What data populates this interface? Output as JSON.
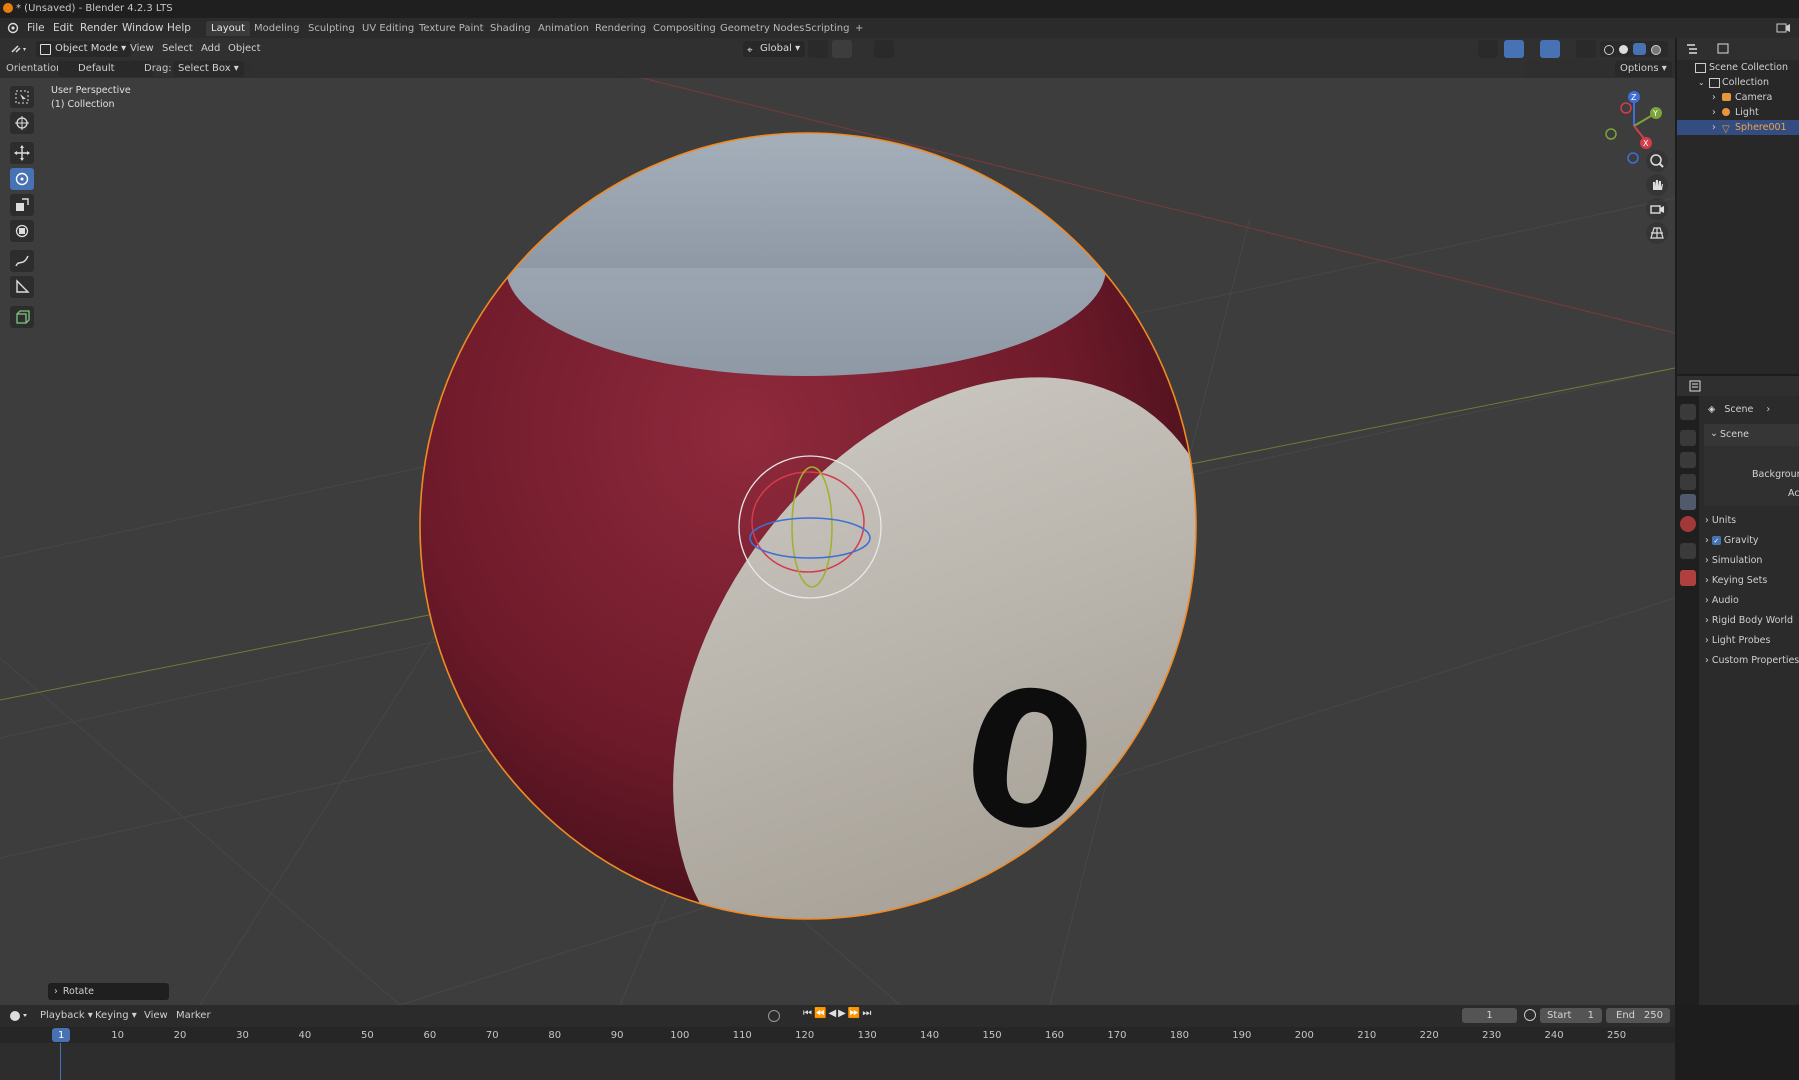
{
  "window": {
    "title": "* (Unsaved) - Blender 4.2.3 LTS"
  },
  "menu": [
    "File",
    "Edit",
    "Render",
    "Window",
    "Help"
  ],
  "workspaces": [
    "Layout",
    "Modeling",
    "Sculpting",
    "UV Editing",
    "Texture Paint",
    "Shading",
    "Animation",
    "Rendering",
    "Compositing",
    "Geometry Nodes",
    "Scripting"
  ],
  "viewport_header": {
    "mode": "Object Mode",
    "menus": [
      "View",
      "Select",
      "Add",
      "Object"
    ],
    "transform_orientation": "Global"
  },
  "tool_header": {
    "orientation_label": "Orientation:",
    "orientation_value": "Default",
    "drag_label": "Drag:",
    "drag_value": "Select Box",
    "options_label": "Options"
  },
  "viewport_info": {
    "view_name": "User Perspective",
    "collection": "(1) Collection"
  },
  "ball": {
    "number": "0",
    "color": "#8b2437"
  },
  "gizmo_axes": [
    "X",
    "Y",
    "Z"
  ],
  "last_operator": "Rotate",
  "outliner": {
    "root": "Scene Collection",
    "collection": "Collection",
    "objects": [
      "Camera",
      "Light",
      "Sphere001"
    ],
    "selected": "Sphere001"
  },
  "properties": {
    "breadcrumb": "Scene",
    "panel": "Scene",
    "fields": [
      "Backgroun",
      "Ac"
    ],
    "subpanels": [
      "Units",
      "Gravity",
      "Simulation",
      "Keying Sets",
      "Audio",
      "Rigid Body World",
      "Light Probes",
      "Custom Properties"
    ],
    "gravity_checked": true
  },
  "timeline": {
    "menus": [
      "Playback",
      "Keying",
      "View",
      "Marker"
    ],
    "current_frame": "1",
    "start_label": "Start",
    "start": "1",
    "end_label": "End",
    "end": "250",
    "ticks": [
      "1",
      "10",
      "20",
      "30",
      "40",
      "50",
      "60",
      "70",
      "80",
      "90",
      "100",
      "110",
      "120",
      "130",
      "140",
      "150",
      "160",
      "170",
      "180",
      "190",
      "200",
      "210",
      "220",
      "230",
      "240",
      "250"
    ]
  },
  "colors": {
    "accent": "#4772b3",
    "selection_outline": "#f08a24",
    "viewport_bg": "#3d3d3d"
  }
}
